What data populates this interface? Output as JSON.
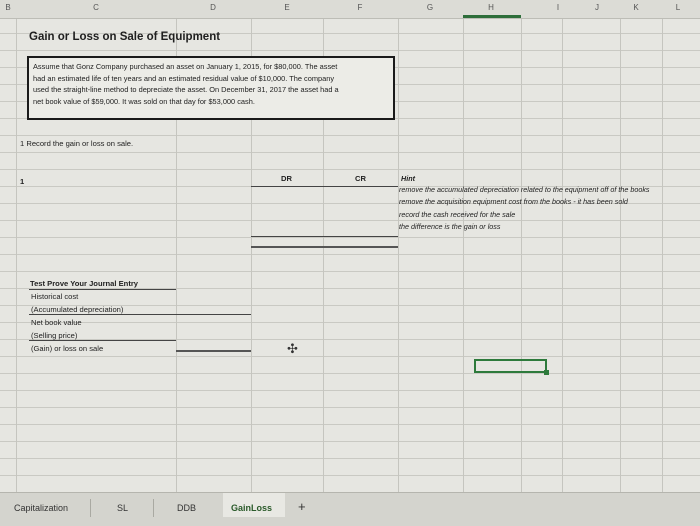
{
  "columns": [
    "B",
    "C",
    "D",
    "E",
    "F",
    "G",
    "H",
    "I",
    "J",
    "K",
    "L"
  ],
  "title": "Gain or Loss on Sale of Equipment",
  "description_lines": [
    "Assume that Gonz Company purchased an asset on January 1, 2015, for $80,000. The asset",
    "had an estimated life of ten years and an estimated residual value of $10,000. The company",
    "used the straight-line method to depreciate the asset. On December 31, 2017 the asset had a",
    "net book value of $59,000. It was sold on that day for $53,000 cash."
  ],
  "task": "1 Record the gain or loss on sale.",
  "journal": {
    "row_number": "1",
    "dr_header": "DR",
    "cr_header": "CR"
  },
  "hint": {
    "title": "Hint",
    "lines": [
      "remove the accumulated depreciation related to the equipment off of the books",
      "remove the acquisition equipment cost from the books - it has been sold",
      "record the cash received for the sale",
      "the difference is the gain or loss"
    ]
  },
  "test": {
    "title": "Test Prove Your Journal Entry",
    "rows": [
      "Historical cost",
      "(Accumulated depreciation)",
      "Net book value",
      "(Selling price)",
      "(Gain) or loss on sale"
    ]
  },
  "tabs": [
    "Capitalization",
    "SL",
    "DDB",
    "GainLoss"
  ],
  "active_tab": "GainLoss",
  "add_sheet": "+"
}
